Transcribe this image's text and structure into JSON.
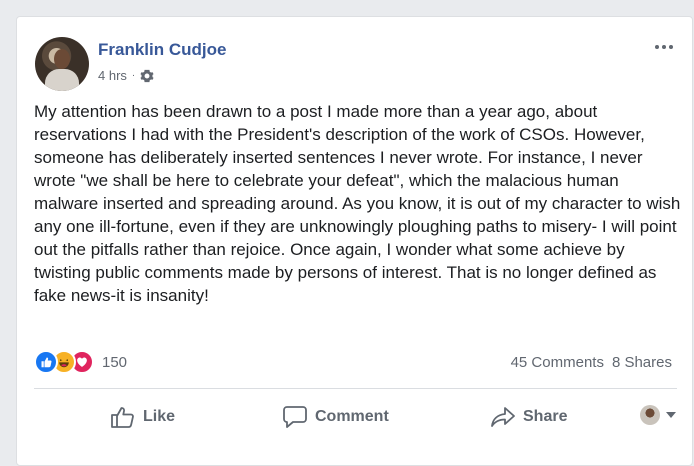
{
  "post": {
    "author": "Franklin Cudjoe",
    "time": "4 hrs",
    "separator": "·",
    "privacy_icon": "gear-icon",
    "text": "My attention has been drawn to a post I made more than a year ago, about reservations I had with the President's description of the work of CSOs. However, someone has deliberately inserted sentences I never wrote. For instance, I never wrote \"we shall be here to celebrate your defeat\", which the malacious human malware inserted and spreading around. As you know, it is out of my character to wish any one ill-fortune, even if they are unknowingly ploughing paths to misery- I will point out the pitfalls rather than rejoice. Once again, I wonder what some achieve by twisting public comments made by persons of interest. That is no longer defined as fake news-it is insanity!"
  },
  "reactions": {
    "icons": [
      "like-icon",
      "haha-icon",
      "love-icon"
    ],
    "count": "150"
  },
  "stats": {
    "comments": "45 Comments",
    "shares": "8 Shares"
  },
  "actions": {
    "like": "Like",
    "comment": "Comment",
    "share": "Share"
  },
  "colors": {
    "link": "#385898",
    "secondary_text": "#616770",
    "like_blue": "#1877f2",
    "haha_yellow": "#f7b125",
    "love_red": "#e0245e"
  }
}
